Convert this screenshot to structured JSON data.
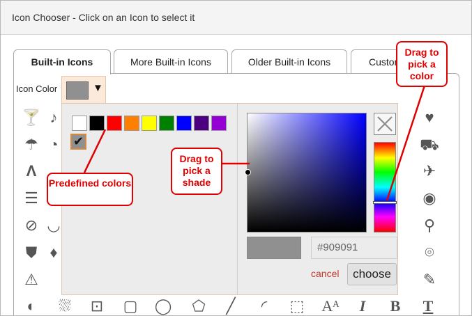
{
  "window": {
    "title": "Icon Chooser - Click on an Icon to select it"
  },
  "tabs": [
    {
      "label": "Built-in Icons",
      "active": true
    },
    {
      "label": "More Built-in Icons",
      "active": false
    },
    {
      "label": "Older Built-in Icons",
      "active": false
    },
    {
      "label": "Custom",
      "active": false
    }
  ],
  "icon_color": {
    "label": "Icon Color",
    "value": "#909091",
    "dropdown_icon": "triangle-down-icon"
  },
  "picker": {
    "predefined_colors": [
      "#ffffff",
      "#000000",
      "#ff0000",
      "#ff8000",
      "#ffff00",
      "#008000",
      "#0000ff",
      "#4b0082",
      "#9400d3"
    ],
    "selected_color": "#909091",
    "hex_value": "#909091",
    "cancel_label": "cancel",
    "choose_label": "choose",
    "no_color_icon": "close-x-icon"
  },
  "callouts": {
    "predefined": "Predefined colors",
    "shade": "Drag to pick a shade",
    "color": "Drag to pick a color"
  },
  "left_icons": [
    "☂",
    "⚘",
    "⛒",
    "☰",
    "⊘",
    "⛊",
    "⚠",
    "◐"
  ],
  "right_icons": [
    "♥",
    "⛟",
    "✈",
    "◉",
    "⚲",
    "⌾",
    "⛏",
    "T"
  ],
  "bottom_icons": [
    "⛆",
    "⊡",
    "▢",
    "◯",
    "⬠",
    "╱",
    "◜",
    "⬚",
    "Aᴬ",
    "I",
    "B",
    "T"
  ],
  "glyph_icons": {
    "martini": "🍸",
    "umbrella": "☂",
    "road": "≡",
    "list": "☰",
    "eye-slash": "⊘",
    "tag": "⛊",
    "warning": "⚠",
    "contrast": "◐",
    "heart": "♥",
    "binoculars": "⛟",
    "plane": "✈",
    "eye": "◉",
    "lightbulb": "⚲",
    "headset": "⌾",
    "eyedropper": "✎",
    "text": "T"
  }
}
